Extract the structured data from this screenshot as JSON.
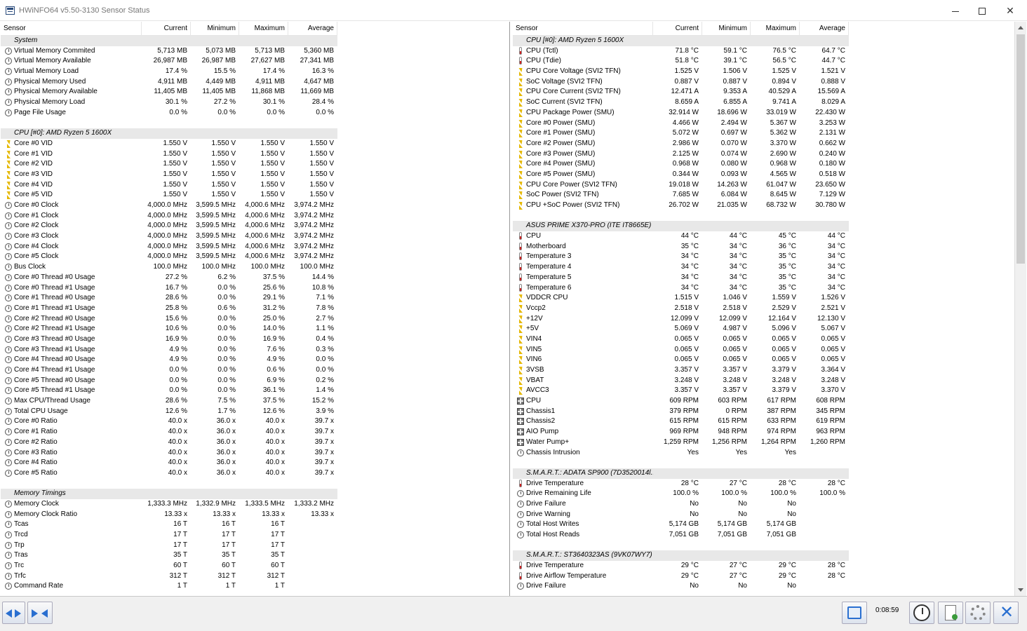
{
  "window": {
    "title": "HWiNFO64 v5.50-3130 Sensor Status"
  },
  "columns": {
    "sensor": "Sensor",
    "current": "Current",
    "minimum": "Minimum",
    "maximum": "Maximum",
    "average": "Average"
  },
  "left_rows": [
    {
      "t": "group",
      "icon": "chip",
      "n": "System"
    },
    {
      "t": "row",
      "icon": "clock",
      "n": "Virtual Memory Commited",
      "c": "5,713 MB",
      "mi": "5,073 MB",
      "ma": "5,713 MB",
      "av": "5,360 MB"
    },
    {
      "t": "row",
      "icon": "clock",
      "n": "Virtual Memory Available",
      "c": "26,987 MB",
      "mi": "26,987 MB",
      "ma": "27,627 MB",
      "av": "27,341 MB"
    },
    {
      "t": "row",
      "icon": "clock",
      "n": "Virtual Memory Load",
      "c": "17.4 %",
      "mi": "15.5 %",
      "ma": "17.4 %",
      "av": "16.3 %"
    },
    {
      "t": "row",
      "icon": "clock",
      "n": "Physical Memory Used",
      "c": "4,911 MB",
      "mi": "4,449 MB",
      "ma": "4,911 MB",
      "av": "4,647 MB"
    },
    {
      "t": "row",
      "icon": "clock",
      "n": "Physical Memory Available",
      "c": "11,405 MB",
      "mi": "11,405 MB",
      "ma": "11,868 MB",
      "av": "11,669 MB"
    },
    {
      "t": "row",
      "icon": "clock",
      "n": "Physical Memory Load",
      "c": "30.1 %",
      "mi": "27.2 %",
      "ma": "30.1 %",
      "av": "28.4 %"
    },
    {
      "t": "row",
      "icon": "clock",
      "n": "Page File Usage",
      "c": "0.0 %",
      "mi": "0.0 %",
      "ma": "0.0 %",
      "av": "0.0 %"
    },
    {
      "t": "blank"
    },
    {
      "t": "group",
      "icon": "chip",
      "n": "CPU [#0]: AMD Ryzen 5 1600X"
    },
    {
      "t": "row",
      "icon": "bolt",
      "n": "Core #0 VID",
      "c": "1.550 V",
      "mi": "1.550 V",
      "ma": "1.550 V",
      "av": "1.550 V"
    },
    {
      "t": "row",
      "icon": "bolt",
      "n": "Core #1 VID",
      "c": "1.550 V",
      "mi": "1.550 V",
      "ma": "1.550 V",
      "av": "1.550 V"
    },
    {
      "t": "row",
      "icon": "bolt",
      "n": "Core #2 VID",
      "c": "1.550 V",
      "mi": "1.550 V",
      "ma": "1.550 V",
      "av": "1.550 V"
    },
    {
      "t": "row",
      "icon": "bolt",
      "n": "Core #3 VID",
      "c": "1.550 V",
      "mi": "1.550 V",
      "ma": "1.550 V",
      "av": "1.550 V"
    },
    {
      "t": "row",
      "icon": "bolt",
      "n": "Core #4 VID",
      "c": "1.550 V",
      "mi": "1.550 V",
      "ma": "1.550 V",
      "av": "1.550 V"
    },
    {
      "t": "row",
      "icon": "bolt",
      "n": "Core #5 VID",
      "c": "1.550 V",
      "mi": "1.550 V",
      "ma": "1.550 V",
      "av": "1.550 V"
    },
    {
      "t": "row",
      "icon": "clock",
      "n": "Core #0 Clock",
      "c": "4,000.0 MHz",
      "mi": "3,599.5 MHz",
      "ma": "4,000.6 MHz",
      "av": "3,974.2 MHz"
    },
    {
      "t": "row",
      "icon": "clock",
      "n": "Core #1 Clock",
      "c": "4,000.0 MHz",
      "mi": "3,599.5 MHz",
      "ma": "4,000.6 MHz",
      "av": "3,974.2 MHz"
    },
    {
      "t": "row",
      "icon": "clock",
      "n": "Core #2 Clock",
      "c": "4,000.0 MHz",
      "mi": "3,599.5 MHz",
      "ma": "4,000.6 MHz",
      "av": "3,974.2 MHz"
    },
    {
      "t": "row",
      "icon": "clock",
      "n": "Core #3 Clock",
      "c": "4,000.0 MHz",
      "mi": "3,599.5 MHz",
      "ma": "4,000.6 MHz",
      "av": "3,974.2 MHz"
    },
    {
      "t": "row",
      "icon": "clock",
      "n": "Core #4 Clock",
      "c": "4,000.0 MHz",
      "mi": "3,599.5 MHz",
      "ma": "4,000.6 MHz",
      "av": "3,974.2 MHz"
    },
    {
      "t": "row",
      "icon": "clock",
      "n": "Core #5 Clock",
      "c": "4,000.0 MHz",
      "mi": "3,599.5 MHz",
      "ma": "4,000.6 MHz",
      "av": "3,974.2 MHz"
    },
    {
      "t": "row",
      "icon": "clock",
      "n": "Bus Clock",
      "c": "100.0 MHz",
      "mi": "100.0 MHz",
      "ma": "100.0 MHz",
      "av": "100.0 MHz"
    },
    {
      "t": "row",
      "icon": "clock",
      "n": "Core #0 Thread #0 Usage",
      "c": "27.2 %",
      "mi": "6.2 %",
      "ma": "37.5 %",
      "av": "14.4 %"
    },
    {
      "t": "row",
      "icon": "clock",
      "n": "Core #0 Thread #1 Usage",
      "c": "16.7 %",
      "mi": "0.0 %",
      "ma": "25.6 %",
      "av": "10.8 %"
    },
    {
      "t": "row",
      "icon": "clock",
      "n": "Core #1 Thread #0 Usage",
      "c": "28.6 %",
      "mi": "0.0 %",
      "ma": "29.1 %",
      "av": "7.1 %"
    },
    {
      "t": "row",
      "icon": "clock",
      "n": "Core #1 Thread #1 Usage",
      "c": "25.8 %",
      "mi": "0.6 %",
      "ma": "31.2 %",
      "av": "7.8 %"
    },
    {
      "t": "row",
      "icon": "clock",
      "n": "Core #2 Thread #0 Usage",
      "c": "15.6 %",
      "mi": "0.0 %",
      "ma": "25.0 %",
      "av": "2.7 %"
    },
    {
      "t": "row",
      "icon": "clock",
      "n": "Core #2 Thread #1 Usage",
      "c": "10.6 %",
      "mi": "0.0 %",
      "ma": "14.0 %",
      "av": "1.1 %"
    },
    {
      "t": "row",
      "icon": "clock",
      "n": "Core #3 Thread #0 Usage",
      "c": "16.9 %",
      "mi": "0.0 %",
      "ma": "16.9 %",
      "av": "0.4 %"
    },
    {
      "t": "row",
      "icon": "clock",
      "n": "Core #3 Thread #1 Usage",
      "c": "4.9 %",
      "mi": "0.0 %",
      "ma": "7.6 %",
      "av": "0.3 %"
    },
    {
      "t": "row",
      "icon": "clock",
      "n": "Core #4 Thread #0 Usage",
      "c": "4.9 %",
      "mi": "0.0 %",
      "ma": "4.9 %",
      "av": "0.0 %"
    },
    {
      "t": "row",
      "icon": "clock",
      "n": "Core #4 Thread #1 Usage",
      "c": "0.0 %",
      "mi": "0.0 %",
      "ma": "0.6 %",
      "av": "0.0 %"
    },
    {
      "t": "row",
      "icon": "clock",
      "n": "Core #5 Thread #0 Usage",
      "c": "0.0 %",
      "mi": "0.0 %",
      "ma": "6.9 %",
      "av": "0.2 %"
    },
    {
      "t": "row",
      "icon": "clock",
      "n": "Core #5 Thread #1 Usage",
      "c": "0.0 %",
      "mi": "0.0 %",
      "ma": "36.1 %",
      "av": "1.4 %"
    },
    {
      "t": "row",
      "icon": "clock",
      "n": "Max CPU/Thread Usage",
      "c": "28.6 %",
      "mi": "7.5 %",
      "ma": "37.5 %",
      "av": "15.2 %"
    },
    {
      "t": "row",
      "icon": "clock",
      "n": "Total CPU Usage",
      "c": "12.6 %",
      "mi": "1.7 %",
      "ma": "12.6 %",
      "av": "3.9 %"
    },
    {
      "t": "row",
      "icon": "clock",
      "n": "Core #0 Ratio",
      "c": "40.0 x",
      "mi": "36.0 x",
      "ma": "40.0 x",
      "av": "39.7 x"
    },
    {
      "t": "row",
      "icon": "clock",
      "n": "Core #1 Ratio",
      "c": "40.0 x",
      "mi": "36.0 x",
      "ma": "40.0 x",
      "av": "39.7 x"
    },
    {
      "t": "row",
      "icon": "clock",
      "n": "Core #2 Ratio",
      "c": "40.0 x",
      "mi": "36.0 x",
      "ma": "40.0 x",
      "av": "39.7 x"
    },
    {
      "t": "row",
      "icon": "clock",
      "n": "Core #3 Ratio",
      "c": "40.0 x",
      "mi": "36.0 x",
      "ma": "40.0 x",
      "av": "39.7 x"
    },
    {
      "t": "row",
      "icon": "clock",
      "n": "Core #4 Ratio",
      "c": "40.0 x",
      "mi": "36.0 x",
      "ma": "40.0 x",
      "av": "39.7 x"
    },
    {
      "t": "row",
      "icon": "clock",
      "n": "Core #5 Ratio",
      "c": "40.0 x",
      "mi": "36.0 x",
      "ma": "40.0 x",
      "av": "39.7 x"
    },
    {
      "t": "blank"
    },
    {
      "t": "group",
      "icon": "chip",
      "n": "Memory Timings"
    },
    {
      "t": "row",
      "icon": "clock",
      "n": "Memory Clock",
      "c": "1,333.3 MHz",
      "mi": "1,332.9 MHz",
      "ma": "1,333.5 MHz",
      "av": "1,333.2 MHz"
    },
    {
      "t": "row",
      "icon": "clock",
      "n": "Memory Clock Ratio",
      "c": "13.33 x",
      "mi": "13.33 x",
      "ma": "13.33 x",
      "av": "13.33 x"
    },
    {
      "t": "row",
      "icon": "clock",
      "n": "Tcas",
      "c": "16 T",
      "mi": "16 T",
      "ma": "16 T",
      "av": ""
    },
    {
      "t": "row",
      "icon": "clock",
      "n": "Trcd",
      "c": "17 T",
      "mi": "17 T",
      "ma": "17 T",
      "av": ""
    },
    {
      "t": "row",
      "icon": "clock",
      "n": "Trp",
      "c": "17 T",
      "mi": "17 T",
      "ma": "17 T",
      "av": ""
    },
    {
      "t": "row",
      "icon": "clock",
      "n": "Tras",
      "c": "35 T",
      "mi": "35 T",
      "ma": "35 T",
      "av": ""
    },
    {
      "t": "row",
      "icon": "clock",
      "n": "Trc",
      "c": "60 T",
      "mi": "60 T",
      "ma": "60 T",
      "av": ""
    },
    {
      "t": "row",
      "icon": "clock",
      "n": "Trfc",
      "c": "312 T",
      "mi": "312 T",
      "ma": "312 T",
      "av": ""
    },
    {
      "t": "row",
      "icon": "clock",
      "n": "Command Rate",
      "c": "1 T",
      "mi": "1 T",
      "ma": "1 T",
      "av": ""
    }
  ],
  "right_rows": [
    {
      "t": "group",
      "icon": "chip",
      "n": "CPU [#0]: AMD Ryzen 5 1600X"
    },
    {
      "t": "row",
      "icon": "therm",
      "n": "CPU (Tctl)",
      "c": "71.8 °C",
      "mi": "59.1 °C",
      "ma": "76.5 °C",
      "av": "64.7 °C"
    },
    {
      "t": "row",
      "icon": "therm",
      "n": "CPU (Tdie)",
      "c": "51.8 °C",
      "mi": "39.1 °C",
      "ma": "56.5 °C",
      "av": "44.7 °C"
    },
    {
      "t": "row",
      "icon": "bolt",
      "n": "CPU Core Voltage (SVI2 TFN)",
      "c": "1.525 V",
      "mi": "1.506 V",
      "ma": "1.525 V",
      "av": "1.521 V"
    },
    {
      "t": "row",
      "icon": "bolt",
      "n": "SoC Voltage (SVI2 TFN)",
      "c": "0.887 V",
      "mi": "0.887 V",
      "ma": "0.894 V",
      "av": "0.888 V"
    },
    {
      "t": "row",
      "icon": "bolt",
      "n": "CPU Core Current (SVI2 TFN)",
      "c": "12.471 A",
      "mi": "9.353 A",
      "ma": "40.529 A",
      "av": "15.569 A"
    },
    {
      "t": "row",
      "icon": "bolt",
      "n": "SoC Current (SVI2 TFN)",
      "c": "8.659 A",
      "mi": "6.855 A",
      "ma": "9.741 A",
      "av": "8.029 A"
    },
    {
      "t": "row",
      "icon": "bolt",
      "n": "CPU Package Power (SMU)",
      "c": "32.914 W",
      "mi": "18.696 W",
      "ma": "33.019 W",
      "av": "22.430 W"
    },
    {
      "t": "row",
      "icon": "bolt",
      "n": "Core #0 Power (SMU)",
      "c": "4.466 W",
      "mi": "2.494 W",
      "ma": "5.367 W",
      "av": "3.253 W"
    },
    {
      "t": "row",
      "icon": "bolt",
      "n": "Core #1 Power (SMU)",
      "c": "5.072 W",
      "mi": "0.697 W",
      "ma": "5.362 W",
      "av": "2.131 W"
    },
    {
      "t": "row",
      "icon": "bolt",
      "n": "Core #2 Power (SMU)",
      "c": "2.986 W",
      "mi": "0.070 W",
      "ma": "3.370 W",
      "av": "0.662 W"
    },
    {
      "t": "row",
      "icon": "bolt",
      "n": "Core #3 Power (SMU)",
      "c": "2.125 W",
      "mi": "0.074 W",
      "ma": "2.690 W",
      "av": "0.240 W"
    },
    {
      "t": "row",
      "icon": "bolt",
      "n": "Core #4 Power (SMU)",
      "c": "0.968 W",
      "mi": "0.080 W",
      "ma": "0.968 W",
      "av": "0.180 W"
    },
    {
      "t": "row",
      "icon": "bolt",
      "n": "Core #5 Power (SMU)",
      "c": "0.344 W",
      "mi": "0.093 W",
      "ma": "4.565 W",
      "av": "0.518 W"
    },
    {
      "t": "row",
      "icon": "bolt",
      "n": "CPU Core Power (SVI2 TFN)",
      "c": "19.018 W",
      "mi": "14.263 W",
      "ma": "61.047 W",
      "av": "23.650 W"
    },
    {
      "t": "row",
      "icon": "bolt",
      "n": "SoC Power (SVI2 TFN)",
      "c": "7.685 W",
      "mi": "6.084 W",
      "ma": "8.645 W",
      "av": "7.129 W"
    },
    {
      "t": "row",
      "icon": "bolt",
      "n": "CPU +SoC Power (SVI2 TFN)",
      "c": "26.702 W",
      "mi": "21.035 W",
      "ma": "68.732 W",
      "av": "30.780 W"
    },
    {
      "t": "blank"
    },
    {
      "t": "group",
      "icon": "chip",
      "n": "ASUS PRIME X370-PRO (ITE IT8665E)"
    },
    {
      "t": "row",
      "icon": "therm",
      "n": "CPU",
      "c": "44 °C",
      "mi": "44 °C",
      "ma": "45 °C",
      "av": "44 °C"
    },
    {
      "t": "row",
      "icon": "therm",
      "n": "Motherboard",
      "c": "35 °C",
      "mi": "34 °C",
      "ma": "36 °C",
      "av": "34 °C"
    },
    {
      "t": "row",
      "icon": "therm",
      "n": "Temperature 3",
      "c": "34 °C",
      "mi": "34 °C",
      "ma": "35 °C",
      "av": "34 °C"
    },
    {
      "t": "row",
      "icon": "therm",
      "n": "Temperature 4",
      "c": "34 °C",
      "mi": "34 °C",
      "ma": "35 °C",
      "av": "34 °C"
    },
    {
      "t": "row",
      "icon": "therm",
      "n": "Temperature 5",
      "c": "34 °C",
      "mi": "34 °C",
      "ma": "35 °C",
      "av": "34 °C"
    },
    {
      "t": "row",
      "icon": "therm",
      "n": "Temperature 6",
      "c": "34 °C",
      "mi": "34 °C",
      "ma": "35 °C",
      "av": "34 °C"
    },
    {
      "t": "row",
      "icon": "bolt",
      "n": "VDDCR CPU",
      "c": "1.515 V",
      "mi": "1.046 V",
      "ma": "1.559 V",
      "av": "1.526 V"
    },
    {
      "t": "row",
      "icon": "bolt",
      "n": "Vccp2",
      "c": "2.518 V",
      "mi": "2.518 V",
      "ma": "2.529 V",
      "av": "2.521 V"
    },
    {
      "t": "row",
      "icon": "bolt",
      "n": "+12V",
      "c": "12.099 V",
      "mi": "12.099 V",
      "ma": "12.164 V",
      "av": "12.130 V"
    },
    {
      "t": "row",
      "icon": "bolt",
      "n": "+5V",
      "c": "5.069 V",
      "mi": "4.987 V",
      "ma": "5.096 V",
      "av": "5.067 V"
    },
    {
      "t": "row",
      "icon": "bolt",
      "n": "VIN4",
      "c": "0.065 V",
      "mi": "0.065 V",
      "ma": "0.065 V",
      "av": "0.065 V"
    },
    {
      "t": "row",
      "icon": "bolt",
      "n": "VIN5",
      "c": "0.065 V",
      "mi": "0.065 V",
      "ma": "0.065 V",
      "av": "0.065 V"
    },
    {
      "t": "row",
      "icon": "bolt",
      "n": "VIN6",
      "c": "0.065 V",
      "mi": "0.065 V",
      "ma": "0.065 V",
      "av": "0.065 V"
    },
    {
      "t": "row",
      "icon": "bolt",
      "n": "3VSB",
      "c": "3.357 V",
      "mi": "3.357 V",
      "ma": "3.379 V",
      "av": "3.364 V"
    },
    {
      "t": "row",
      "icon": "bolt",
      "n": "VBAT",
      "c": "3.248 V",
      "mi": "3.248 V",
      "ma": "3.248 V",
      "av": "3.248 V"
    },
    {
      "t": "row",
      "icon": "bolt",
      "n": "AVCC3",
      "c": "3.357 V",
      "mi": "3.357 V",
      "ma": "3.379 V",
      "av": "3.370 V"
    },
    {
      "t": "row",
      "icon": "fan",
      "n": "CPU",
      "c": "609 RPM",
      "mi": "603 RPM",
      "ma": "617 RPM",
      "av": "608 RPM"
    },
    {
      "t": "row",
      "icon": "fan",
      "n": "Chassis1",
      "c": "379 RPM",
      "mi": "0 RPM",
      "ma": "387 RPM",
      "av": "345 RPM"
    },
    {
      "t": "row",
      "icon": "fan",
      "n": "Chassis2",
      "c": "615 RPM",
      "mi": "615 RPM",
      "ma": "633 RPM",
      "av": "619 RPM"
    },
    {
      "t": "row",
      "icon": "fan",
      "n": "AIO Pump",
      "c": "969 RPM",
      "mi": "948 RPM",
      "ma": "974 RPM",
      "av": "963 RPM"
    },
    {
      "t": "row",
      "icon": "fan",
      "n": "Water Pump+",
      "c": "1,259 RPM",
      "mi": "1,256 RPM",
      "ma": "1,264 RPM",
      "av": "1,260 RPM"
    },
    {
      "t": "row",
      "icon": "clock",
      "n": "Chassis Intrusion",
      "c": "Yes",
      "mi": "Yes",
      "ma": "Yes",
      "av": ""
    },
    {
      "t": "blank"
    },
    {
      "t": "group",
      "icon": "chip",
      "n": "S.M.A.R.T.: ADATA SP900 (7D3520014l..."
    },
    {
      "t": "row",
      "icon": "therm",
      "n": "Drive Temperature",
      "c": "28 °C",
      "mi": "27 °C",
      "ma": "28 °C",
      "av": "28 °C"
    },
    {
      "t": "row",
      "icon": "clock",
      "n": "Drive Remaining Life",
      "c": "100.0 %",
      "mi": "100.0 %",
      "ma": "100.0 %",
      "av": "100.0 %"
    },
    {
      "t": "row",
      "icon": "clock",
      "n": "Drive Failure",
      "c": "No",
      "mi": "No",
      "ma": "No",
      "av": ""
    },
    {
      "t": "row",
      "icon": "clock",
      "n": "Drive Warning",
      "c": "No",
      "mi": "No",
      "ma": "No",
      "av": ""
    },
    {
      "t": "row",
      "icon": "clock",
      "n": "Total Host Writes",
      "c": "5,174 GB",
      "mi": "5,174 GB",
      "ma": "5,174 GB",
      "av": ""
    },
    {
      "t": "row",
      "icon": "clock",
      "n": "Total Host Reads",
      "c": "7,051 GB",
      "mi": "7,051 GB",
      "ma": "7,051 GB",
      "av": ""
    },
    {
      "t": "blank"
    },
    {
      "t": "group",
      "icon": "chip",
      "n": "S.M.A.R.T.: ST3640323AS (9VK07WY7)"
    },
    {
      "t": "row",
      "icon": "therm",
      "n": "Drive Temperature",
      "c": "29 °C",
      "mi": "27 °C",
      "ma": "29 °C",
      "av": "28 °C"
    },
    {
      "t": "row",
      "icon": "therm",
      "n": "Drive Airflow Temperature",
      "c": "29 °C",
      "mi": "27 °C",
      "ma": "29 °C",
      "av": "28 °C"
    },
    {
      "t": "row",
      "icon": "clock",
      "n": "Drive Failure",
      "c": "No",
      "mi": "No",
      "ma": "No",
      "av": ""
    }
  ],
  "bottombar": {
    "timer": "0:08:59"
  }
}
